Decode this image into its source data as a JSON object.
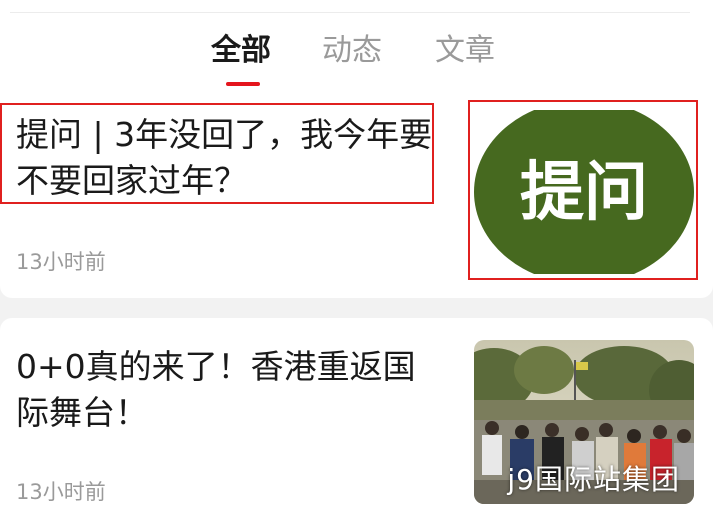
{
  "tabs": [
    {
      "label": "全部",
      "active": true
    },
    {
      "label": "动态",
      "active": false
    },
    {
      "label": "文章",
      "active": false
    }
  ],
  "articles": [
    {
      "title": "提问 | 3年没回了，我今年要不要回家过年？",
      "time": "13小时前",
      "thumbnail": {
        "text": "提问",
        "color": "#46691f"
      }
    },
    {
      "title": "0+0真的来了！香港重返国际舞台！",
      "time": "13小时前",
      "thumbnail": {
        "text": "",
        "scene": "crowd-photo"
      }
    }
  ],
  "watermark": "j9国际站集团",
  "colors": {
    "accent": "#e4151d",
    "highlight": "#e0201f",
    "thumb_green": "#46691f"
  }
}
